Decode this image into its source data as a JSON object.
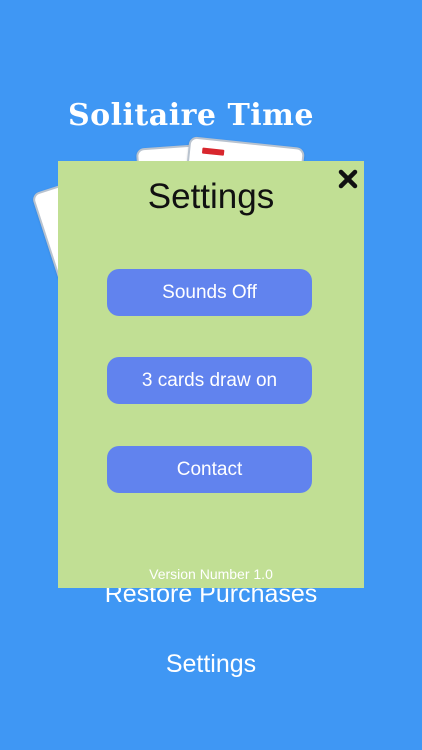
{
  "app": {
    "title": "Solitaire Time"
  },
  "menu": {
    "restore_label": "Restore Purchases",
    "settings_label": "Settings"
  },
  "settings_panel": {
    "title": "Settings",
    "close_icon": "close-icon",
    "buttons": [
      {
        "label": "Sounds Off"
      },
      {
        "label": "3 cards draw on"
      },
      {
        "label": "Contact"
      }
    ],
    "version": "Version Number 1.0"
  },
  "colors": {
    "background": "#3f97f4",
    "panel": "#c1df94",
    "button": "#6183ee"
  }
}
